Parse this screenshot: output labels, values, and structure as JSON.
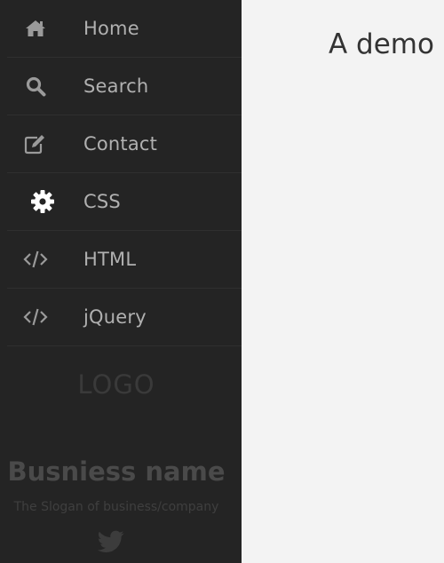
{
  "sidebar": {
    "items": [
      {
        "label": "Home",
        "icon": "home-icon"
      },
      {
        "label": "Search",
        "icon": "search-icon"
      },
      {
        "label": "Contact",
        "icon": "edit-icon"
      },
      {
        "label": "CSS",
        "icon": "gear-icon"
      },
      {
        "label": "HTML",
        "icon": "code-icon"
      },
      {
        "label": "jQuery",
        "icon": "code-icon"
      }
    ],
    "logo": "LOGO",
    "business_name": "Busniess name",
    "slogan": "The Slogan of business/company",
    "social_icon": "twitter-icon"
  },
  "main": {
    "title": "A demo"
  },
  "colors": {
    "sidebar_bg": "#242424",
    "main_bg": "#f3f3f3",
    "nav_text": "#b0b0b0"
  }
}
